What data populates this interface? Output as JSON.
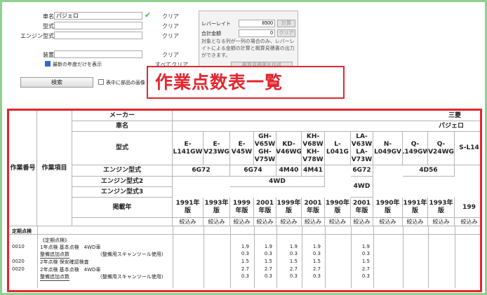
{
  "search": {
    "maker_label": "車名",
    "maker_value": "パジェロ",
    "type_label": "型式",
    "engine_label": "エンジン型式",
    "equip_label": "装置",
    "clear_label": "クリア",
    "clear_all_label": "すべてクリア",
    "latest_label": "最新の年度だけを表示",
    "search_button": "検索",
    "show_parts_label": "表中に部品の画像"
  },
  "panel": {
    "rate_label": "レバーレイト",
    "rate_value": "8500",
    "total_label": "合計金額",
    "total_value": "0",
    "calc_button": "計算",
    "clear_button": "クリア",
    "note": "対象となる列が一列の場合のみ、レバーレイトによる金額の計算と概算見積書の出力ができます。",
    "estimate_button": "概算見積書を作成"
  },
  "callout": {
    "title": "作業点数表一覧"
  },
  "table": {
    "col_no_header": "作業番号",
    "col_item_header": "作業項目",
    "maker_label": "メーカー",
    "maker_value": "三菱",
    "car_label": "車名",
    "car_value": "パジェロ",
    "type_label": "型式",
    "engine_label": "エンジン型式",
    "engine2_label": "エンジン型式2",
    "engine3_label": "エンジン型式3",
    "year_label": "掲載年",
    "types": [
      "E-L141GW",
      "E-V23WG",
      "E-V45W",
      "GH-V65W GH-V75W",
      "KD-V46WG",
      "KH-V68W KH-V78W",
      "L-L041G",
      "LA-V63W LA-V73W",
      "N-L049GV",
      "Q-L149GW",
      "Q-V24WG",
      "S-L14"
    ],
    "engines": [
      "6G72",
      "6G74",
      "4M40",
      "4M41",
      "6G72",
      "4D56"
    ],
    "engine2": [
      "4WD",
      "4WD"
    ],
    "years": [
      "1991年版",
      "1993年版",
      "1999年版",
      "2001年版",
      "1999年版",
      "2001年版",
      "1990年版",
      "2001年版",
      "1990年版",
      "1991年版",
      "1993年版",
      "199"
    ],
    "filter_label": "絞込み",
    "section_label": "定期点検",
    "group_label": "《定期点検》",
    "rows": [
      {
        "no": "0010",
        "item": "1年点検 基本点検　4WD車",
        "vals": [
          "1.9",
          "1.9",
          "1.9",
          "1.9",
          "",
          "1.9"
        ]
      },
      {
        "no": "",
        "item": "整備追加点数",
        "sub": "(整備用スキャンツール使用)",
        "vals": [
          "0.3",
          "0.3",
          "0.3",
          "0.3",
          "",
          "0.3"
        ]
      },
      {
        "no": "0020",
        "item": "2年点検 保安確認検査",
        "vals": [
          "1.5",
          "1.5",
          "1.5",
          "1.5",
          "",
          "1.5"
        ]
      },
      {
        "no": "0020",
        "item": "2年点検 基本点検　4WD車",
        "vals": [
          "2.7",
          "2.7",
          "2.7",
          "2.7",
          "",
          "2.7"
        ]
      },
      {
        "no": "",
        "item": "整備追加点数",
        "sub": "(整備用スキャンツール使用)",
        "vals": [
          "0.3",
          "0.3",
          "0.3",
          "0.3",
          "",
          "0.3"
        ]
      }
    ]
  }
}
